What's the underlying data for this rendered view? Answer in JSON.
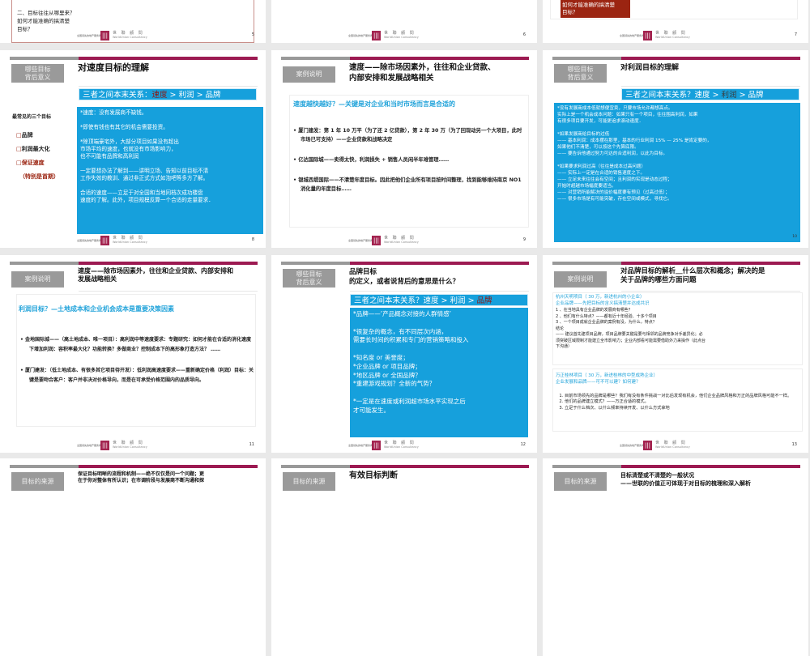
{
  "footer": {
    "company_cn": "世 聯 顧 問",
    "company_en": "WorldUnion Consultancy",
    "small": "全国领先的地产服务商",
    "logo_char": "ണ"
  },
  "slide5": {
    "number": "5",
    "text": "二、目标往往从哪里来？\n如何才能准确的搞清楚\n目标？"
  },
  "slide6": {
    "number": "6"
  },
  "slide7": {
    "number": "7",
    "text": "如何才能准确的搞清楚\n目标？"
  },
  "slide8": {
    "number": "8",
    "tag": "哪些目标\n背后意义",
    "title": "对速度目标的理解",
    "header": {
      "prefix": "三者之间本末关系：",
      "a": "速度",
      "sep": " > ",
      "b": "利润",
      "c": "品牌"
    },
    "left_title": "最常见的三个目标",
    "goals": [
      "品牌",
      "利润最大化",
      "保证速度"
    ],
    "goal_note": "（特别是首期）",
    "body": "*速度：没有发展商不缺钱。\n\n*即使有钱也有其它的机会需要投资。\n\n*除顶端豪宅外，大部分项目如果没有超出\n市场平均的速度，也就没有市场影响力，\n也不可能有品牌和高利润\n\n一定要想办法了解到——讲明立场、告知以前目标不清\n工作失效的教训、通过非正式方式如泡吧等多方了解。\n\n合适的速度——立足于对全国和当地同档次成功楼盘\n速度的了解。此外，项目规模反算一个合适的走量要求．"
  },
  "slide9": {
    "number": "9",
    "tag": "案例说明",
    "title": "速度——除市场因素外，往往和企业贷款、\n内部安排和发展战略相关",
    "subtitle": "速度越快越好？—关键是对企业和当时市场而言是合适的",
    "bullets": [
      "厦门建发：第 1 年 10 万平（为了还 2 亿贷款），第 2 年 30 万（为了回现动另一个大项目，此时市场已可支持）——企业贷款和战略决定",
      "亿达国际城——卖得太快，利润损失 + 销售人员闲半年难管理……",
      "银城西堤国际——不清楚年度目标。因此把他们企业所有项目按时间整理，找到能够维持南京 NO1 消化量的年度目标……"
    ]
  },
  "slide10": {
    "number": "10",
    "tag": "哪些目标\n背后意义",
    "title": "对利润目标的理解",
    "header": {
      "prefix": "三者之间本末关系？",
      "a": "速度",
      "sep": " > ",
      "b": "利润",
      "c": "品牌"
    },
    "body": "*没有发展商成本低就想便宜卖，只要市场允许都想高点。\n实际上是一个机会成本问题：如果只有一个项目，往往围高利润，如果\n有很多项目要开发，可能更追求滚动速度．\n\n*如果发展商给目标的过低\n—— 基本利润：成本摆在那里，基本的行业利润 15% — 25% 是肯定要的，\n如果他们不清楚，可以按这个先算底限。\n—— 要告诉他通过努力可达的合适利润，以此为目标。\n\n*如果要求利润过高（往往是成本过高问题）\n—— 实际上一定是在合适的销售速度之下。\n—— 立足未来往往会有空间；且利润的实现是动态过程；\n     开始时超越市场幅度要适当。\n—— 对营销所能解决的溢价幅度要有预见（过高过低）；\n—— 很多市场是有可能突破，存在空间或模式，寻找它。"
  },
  "slide11": {
    "number": "11",
    "tag": "案例说明",
    "title": "速度——除市场因素外，往往和企业贷款、内部安排和\n发展战略相关",
    "subtitle": "利润目标？—土地成本和企业机会成本是重要决策因素",
    "bullets": [
      "金地国际城——（高土地成本、唯一项目）：高利润中等速度要求：专题研究：如何才能在合适的消化速度下增加利润：容积率最大化？功能转换？多做商业？控制成本下的高形象打造方法？ ……",
      "厦门建发：（低土地成本、有很多其它项目待开发）：低利润高速度要求——重新确定价格（利润）目标：关键是要吻合客户：客户并非决对价格导向，而是在可承受价格范围内的品质导向。"
    ]
  },
  "slide12": {
    "number": "12",
    "tag": "哪些目标\n背后意义",
    "title": "品牌目标\n的定义，或者说背后的意思是什么？",
    "header": {
      "prefix": "三者之间本末关系？",
      "a": "速度",
      "sep": " > ",
      "b": "利润",
      "c": "品牌"
    },
    "body": "*品牌——’产品概念对接的人群情感’\n\n*很复杂的概念，有不同层次内涵，\n需要长时间的积累和专门的营销策略和投入\n\n*知名度 or 美誉度；\n*企业品牌 or 项目品牌；\n*地区品牌 or 全国品牌？\n*重建游戏规划？全新的气势？\n\n*一定是在速度或利润超市场水平实现之后\n才可能发生。"
  },
  "slide13": {
    "number": "13",
    "tag": "案例说明",
    "title": "对品牌目标的解析＿什么层次和概念；解决的是\n关于品牌的哪些方面问题",
    "case1_head": "杭州天明项目（ 30 万，新进杭州的小企业）\n企业品牌——先把目标的含义搞清楚并达成共识",
    "case1_body": "1 、在当地具有企业品牌的发展商有哪些？\n2 、他们有什么特点？——都有近十年经验、十多个项目\n3 、一个项目成就企业品牌的案例有没，为什么，特点？\n结论\n—— 建议首先建项目品牌，项目品牌要关键是要与相邻的品牌竞争对手差异化；必\n     须突破区域限制才能建立全市影响力；企业内部看可能需要借助外力来操作（此点台\n     下沟通）",
    "case2_head": "万正桂林项目（ 30 万，新进桂林的中型成熟企业）\n企业发展和品牌——可不可以建？如何建？",
    "case2_items": [
      "目前市场领先的品牌是哪些？我们有没有条件挑战一对比后发现有机会，他们企业品牌风格和万正的品牌风格可能不一样。",
      "他们的品牌建立模式？——万正合适的模式。",
      "立足于什么档次、以什么频率持续开发、以什么方式拿地"
    ]
  },
  "slide14": {
    "tag": "目标的来源",
    "title": "保证目标明晰的流程和机制——绝不仅仅是问一个问题；更\n在于你对整体有所认识；在市调阶段与发展商不断沟通和探"
  },
  "slide15": {
    "tag": "目标的来源",
    "title": "有效目标判断"
  },
  "slide16": {
    "tag": "目标的来源",
    "title": "目标清楚或不清楚的一般状况\n——世联的价值正可体现于对目标的梳理和深入解析"
  }
}
